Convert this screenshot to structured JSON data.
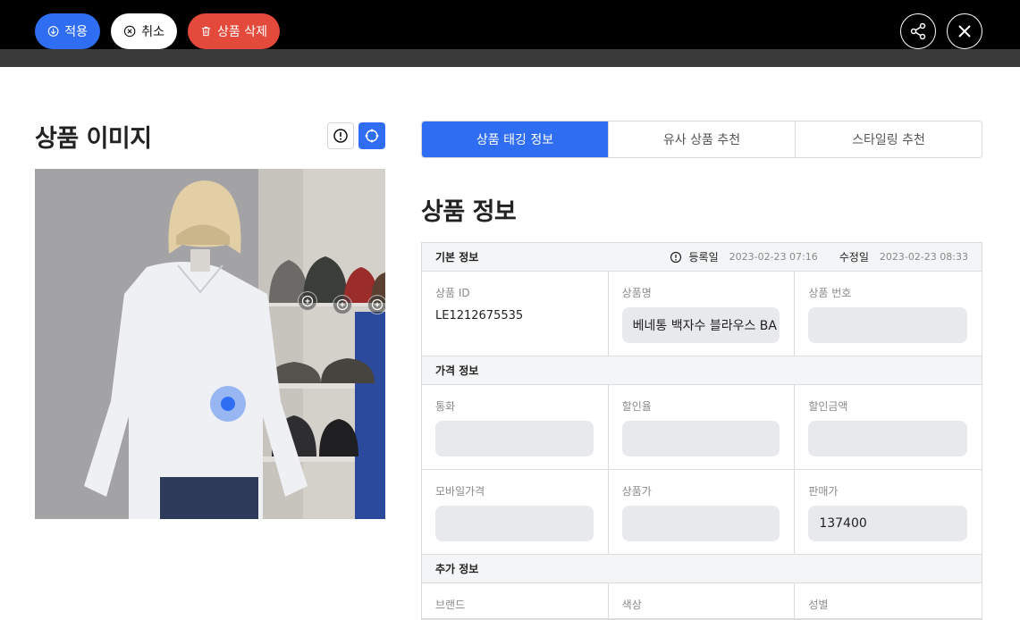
{
  "toolbar": {
    "apply_label": "적용",
    "cancel_label": "취소",
    "delete_label": "상품 삭제",
    "share_icon": "share-icon",
    "close_icon": "close-icon"
  },
  "image_panel": {
    "title": "상품 이미지"
  },
  "tabs": [
    {
      "label": "상품 태깅 정보",
      "active": true
    },
    {
      "label": "유사 상품 추천",
      "active": false
    },
    {
      "label": "스타일링 추천",
      "active": false
    }
  ],
  "product_info": {
    "title": "상품 정보",
    "basic": {
      "header": "기본 정보",
      "registered_label": "등록일",
      "registered_value": "2023-02-23 07:16",
      "modified_label": "수정일",
      "modified_value": "2023-02-23 08:33",
      "product_id_label": "상품 ID",
      "product_id_value": "LE1212675535",
      "product_name_label": "상품명",
      "product_name_value": "베네통 백자수 블라우스 BA",
      "product_number_label": "상품 번호",
      "product_number_value": ""
    },
    "price": {
      "header": "가격 정보",
      "currency_label": "통화",
      "currency_value": "",
      "discount_rate_label": "할인율",
      "discount_rate_value": "",
      "discount_amount_label": "할인금액",
      "discount_amount_value": "",
      "mobile_price_label": "모바일가격",
      "mobile_price_value": "",
      "list_price_label": "상품가",
      "list_price_value": "",
      "sale_price_label": "판매가",
      "sale_price_value": "137400"
    },
    "extra": {
      "header": "추가 정보",
      "brand_label": "브랜드",
      "color_label": "색상",
      "gender_label": "성별"
    }
  },
  "colors": {
    "accent": "#2f6ef2",
    "danger": "#e34a3c"
  }
}
